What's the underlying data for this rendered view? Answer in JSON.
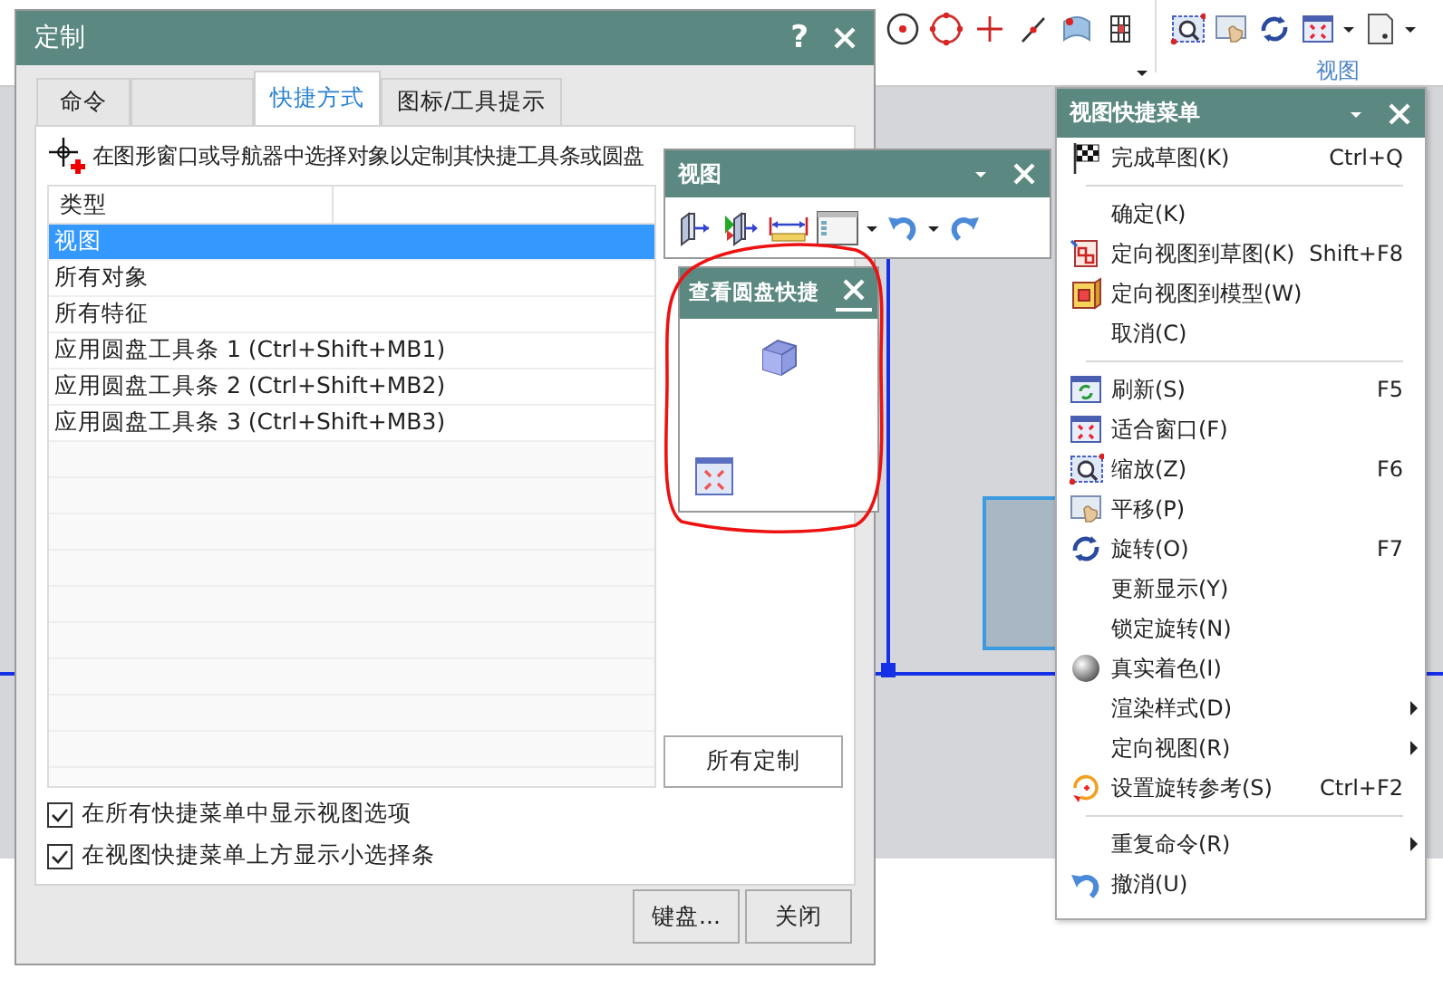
{
  "toolbar": {
    "group_label": "视图"
  },
  "dialog": {
    "title": "定制",
    "help": "?",
    "tabs": [
      {
        "label": "命令",
        "selected": false
      },
      {
        "label": "快捷方式",
        "selected": true
      },
      {
        "label": "图标/工具提示",
        "selected": false
      }
    ],
    "hint": "在图形窗口或导航器中选择对象以定制其快捷工具条或圆盘",
    "list": {
      "columns": [
        "类型"
      ],
      "rows": [
        {
          "label": "视图",
          "selected": true
        },
        {
          "label": "所有对象",
          "selected": false
        },
        {
          "label": "所有特征",
          "selected": false
        },
        {
          "label": "应用圆盘工具条 1 (Ctrl+Shift+MB1)",
          "selected": false
        },
        {
          "label": "应用圆盘工具条 2 (Ctrl+Shift+MB2)",
          "selected": false
        },
        {
          "label": "应用圆盘工具条 3 (Ctrl+Shift+MB3)",
          "selected": false
        }
      ]
    },
    "side_button": "所有定制",
    "checkboxes": [
      {
        "label": "在所有快捷菜单中显示视图选项",
        "checked": true
      },
      {
        "label": "在视图快捷菜单上方显示小选择条",
        "checked": true
      }
    ],
    "buttons": [
      "键盘...",
      "关闭"
    ]
  },
  "view_toolbar": {
    "title": "视图"
  },
  "radial_window": {
    "title": "查看圆盘快捷"
  },
  "menu": {
    "title": "视图快捷菜单",
    "items": [
      {
        "kind": "item",
        "label": "完成草图(K)",
        "shortcut": "Ctrl+Q",
        "submenu": false
      },
      {
        "kind": "separator"
      },
      {
        "kind": "item",
        "label": "确定(K)",
        "submenu": false
      },
      {
        "kind": "item",
        "label": "定向视图到草图(K)",
        "shortcut": "Shift+F8",
        "submenu": false
      },
      {
        "kind": "item",
        "label": "定向视图到模型(W)",
        "submenu": false
      },
      {
        "kind": "item",
        "label": "取消(C)",
        "submenu": false
      },
      {
        "kind": "separator"
      },
      {
        "kind": "item",
        "label": "刷新(S)",
        "shortcut": "F5",
        "submenu": false
      },
      {
        "kind": "item",
        "label": "适合窗口(F)",
        "submenu": false
      },
      {
        "kind": "item",
        "label": "缩放(Z)",
        "shortcut": "F6",
        "submenu": false
      },
      {
        "kind": "item",
        "label": "平移(P)",
        "submenu": false
      },
      {
        "kind": "item",
        "label": "旋转(O)",
        "shortcut": "F7",
        "submenu": false
      },
      {
        "kind": "item",
        "label": "更新显示(Y)",
        "submenu": false
      },
      {
        "kind": "item",
        "label": "锁定旋转(N)",
        "submenu": false
      },
      {
        "kind": "item",
        "label": "真实着色(I)",
        "submenu": false
      },
      {
        "kind": "item",
        "label": "渲染样式(D)",
        "submenu": true
      },
      {
        "kind": "item",
        "label": "定向视图(R)",
        "submenu": true
      },
      {
        "kind": "item",
        "label": "设置旋转参考(S)",
        "shortcut": "Ctrl+F2",
        "submenu": false
      },
      {
        "kind": "separator"
      },
      {
        "kind": "item",
        "label": "重复命令(R)",
        "submenu": true
      },
      {
        "kind": "item",
        "label": "撤消(U)",
        "submenu": false
      }
    ]
  }
}
